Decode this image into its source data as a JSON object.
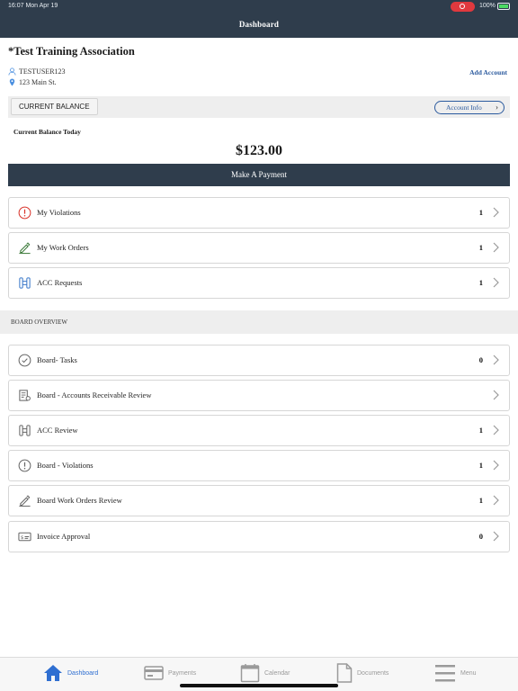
{
  "status_bar": {
    "time": "16:07  Mon Apr 19",
    "battery": "100%"
  },
  "header": {
    "title": "Dashboard"
  },
  "account": {
    "association": "*Test Training Association",
    "username": "TESTUSER123",
    "address": "123 Main St.",
    "add_account_label": "Add Account"
  },
  "balance": {
    "tab_label": "CURRENT BALANCE",
    "account_info_label": "Account Info",
    "today_label": "Current Balance Today",
    "amount": "$123.00",
    "pay_button": "Make A Payment"
  },
  "my_items": [
    {
      "label": "My Violations",
      "count": "1",
      "icon": "violation-icon"
    },
    {
      "label": "My Work Orders",
      "count": "1",
      "icon": "work-order-icon"
    },
    {
      "label": "ACC Requests",
      "count": "1",
      "icon": "acc-icon"
    }
  ],
  "board_section_label": "BOARD OVERVIEW",
  "board_items": [
    {
      "label": "Board- Tasks",
      "count": "0",
      "icon": "task-check-icon"
    },
    {
      "label": "Board - Accounts Receivable Review",
      "count": "",
      "icon": "receivable-icon"
    },
    {
      "label": "ACC Review",
      "count": "1",
      "icon": "acc-icon"
    },
    {
      "label": "Board - Violations",
      "count": "1",
      "icon": "violation-icon"
    },
    {
      "label": "Board Work Orders Review",
      "count": "1",
      "icon": "work-order-icon"
    },
    {
      "label": "Invoice Approval",
      "count": "0",
      "icon": "invoice-icon"
    }
  ],
  "tabbar": [
    {
      "label": "Dashboard",
      "icon": "home-icon",
      "active": true
    },
    {
      "label": "Payments",
      "icon": "credit-card-icon",
      "active": false
    },
    {
      "label": "Calendar",
      "icon": "calendar-icon",
      "active": false
    },
    {
      "label": "Documents",
      "icon": "document-icon",
      "active": false
    },
    {
      "label": "Menu",
      "icon": "hamburger-icon",
      "active": false
    }
  ],
  "colors": {
    "header": "#2f3d4c",
    "accent": "#2b5a9e",
    "tab_active": "#2f6fd1",
    "violation": "#d9342b"
  }
}
